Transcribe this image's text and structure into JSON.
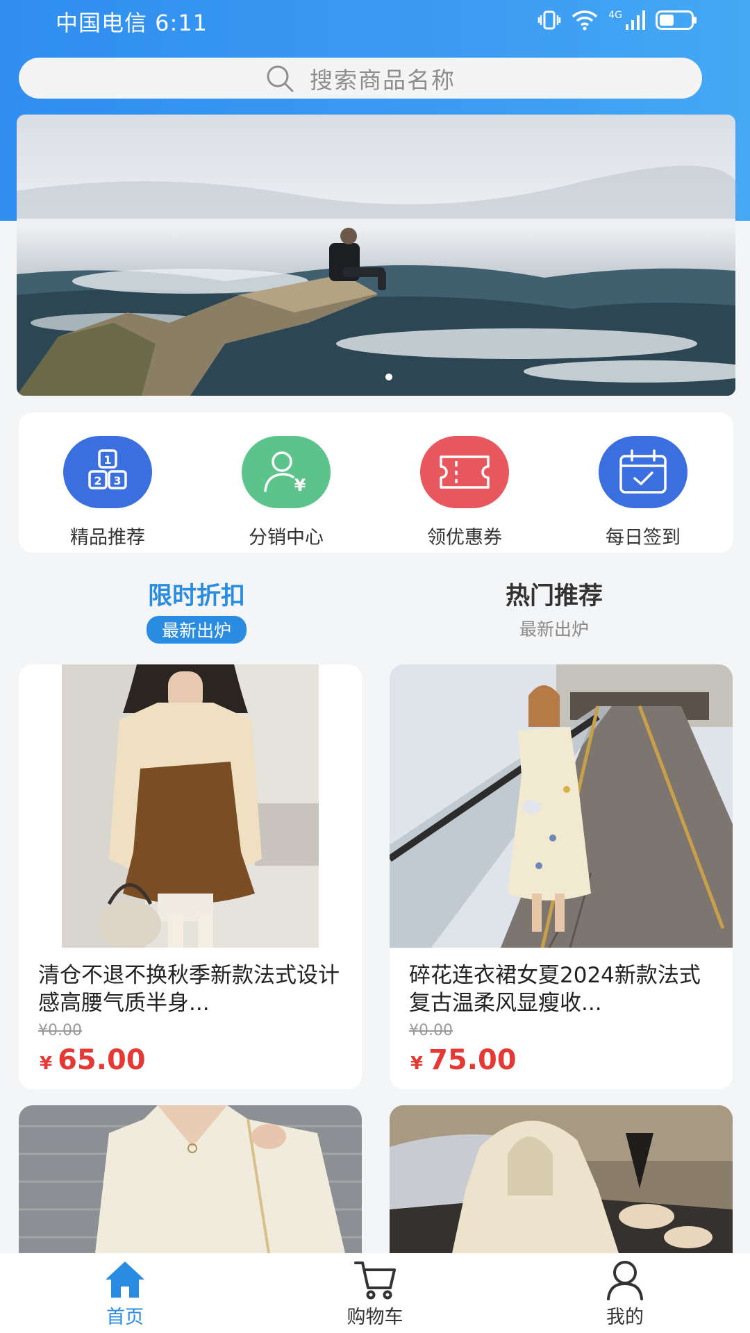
{
  "status_bar": {
    "carrier_time": "中国电信 6:11",
    "network": "4G"
  },
  "search": {
    "placeholder": "搜索商品名称"
  },
  "categories": [
    {
      "label": "精品推荐",
      "icon": "blocks-123-icon",
      "color": "#3b6fe0"
    },
    {
      "label": "分销中心",
      "icon": "user-yen-icon",
      "color": "#5cc48a"
    },
    {
      "label": "领优惠券",
      "icon": "ticket-icon",
      "color": "#e8565e"
    },
    {
      "label": "每日签到",
      "icon": "calendar-check-icon",
      "color": "#3b6fe0"
    }
  ],
  "tabs": [
    {
      "title": "限时折扣",
      "sub": "最新出炉",
      "active": true
    },
    {
      "title": "热门推荐",
      "sub": "最新出炉",
      "active": false
    }
  ],
  "products": [
    {
      "title": "清仓不退不换秋季新款法式设计感高腰气质半身...",
      "orig_price": "¥0.00",
      "currency": "¥",
      "price": "65.00"
    },
    {
      "title": "碎花连衣裙女夏2024新款法式复古温柔风显瘦收...",
      "orig_price": "¥0.00",
      "currency": "¥",
      "price": "75.00"
    },
    {
      "title": "",
      "orig_price": "",
      "currency": "",
      "price": ""
    },
    {
      "title": "",
      "orig_price": "",
      "currency": "",
      "price": ""
    }
  ],
  "tabbar": [
    {
      "label": "首页",
      "icon": "home-icon",
      "active": true
    },
    {
      "label": "购物车",
      "icon": "cart-icon",
      "active": false
    },
    {
      "label": "我的",
      "icon": "user-icon",
      "active": false
    }
  ],
  "colors": {
    "primary": "#2a8ce0",
    "price": "#e53935",
    "header": "#3b9bf2"
  }
}
